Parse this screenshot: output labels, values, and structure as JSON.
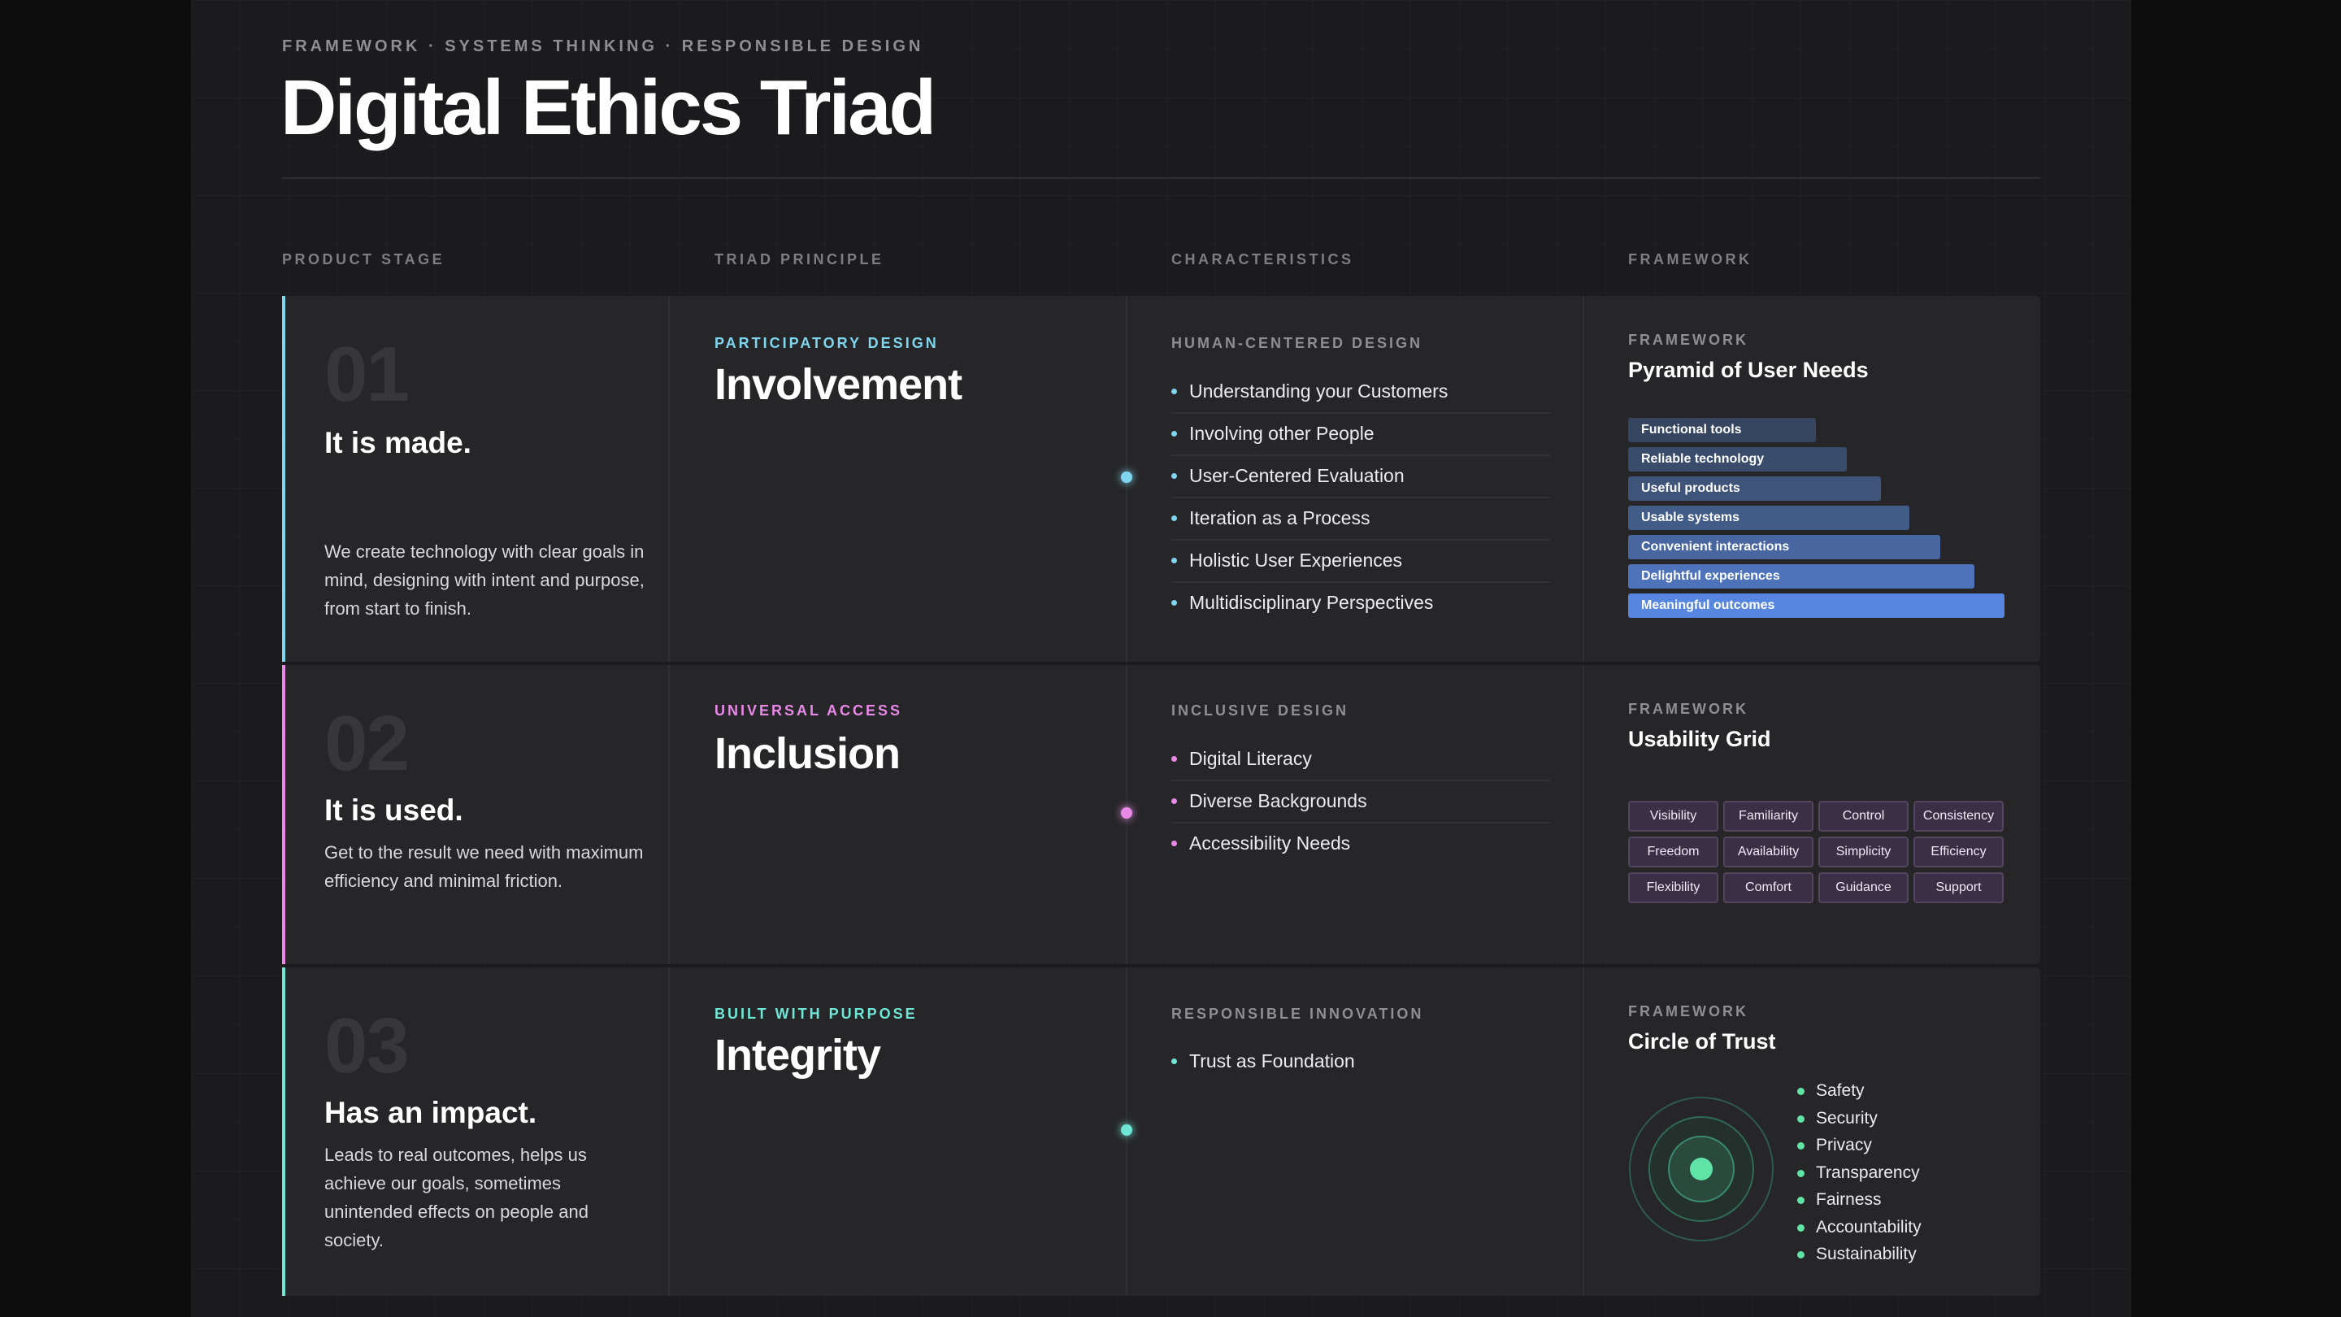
{
  "header": {
    "eyebrow": "FRAMEWORK · SYSTEMS THINKING · RESPONSIBLE DESIGN",
    "title": "Digital Ethics Triad"
  },
  "columns": [
    "PRODUCT STAGE",
    "TRIAD PRINCIPLE",
    "CHARACTERISTICS",
    "FRAMEWORK"
  ],
  "colors": {
    "row1_accent": "#7fd6ef",
    "row2_accent": "#e889e8",
    "row3_accent": "#6fe6d6",
    "pyramid_light": "#3a4c72",
    "pyramid_strong": "#5686e0",
    "trust_green": "#5fe3a7"
  },
  "rows": [
    {
      "number": "01",
      "stage_title": "It is made.",
      "stage_desc": "We create technology with clear goals in mind, designing with intent and purpose, from start to finish.",
      "tag": "PARTICIPATORY DESIGN",
      "principle": "Involvement",
      "char_heading": "HUMAN-CENTERED DESIGN",
      "characteristics": [
        "Understanding your Customers",
        "Involving other People",
        "User-Centered Evaluation",
        "Iteration as a Process",
        "Holistic User Experiences",
        "Multidisciplinary Perspectives"
      ],
      "framework_label": "FRAMEWORK",
      "framework_title": "Pyramid of User Needs",
      "pyramid": [
        "Functional tools",
        "Reliable technology",
        "Useful products",
        "Usable systems",
        "Convenient interactions",
        "Delightful experiences",
        "Meaningful outcomes"
      ]
    },
    {
      "number": "02",
      "stage_title": "It is used.",
      "stage_desc": "Get to the result we need with maximum efficiency and minimal friction.",
      "tag": "UNIVERSAL ACCESS",
      "principle": "Inclusion",
      "char_heading": "INCLUSIVE DESIGN",
      "characteristics": [
        "Digital Literacy",
        "Diverse Backgrounds",
        "Accessibility Needs"
      ],
      "framework_label": "FRAMEWORK",
      "framework_title": "Usability Grid",
      "grid": [
        "Visibility",
        "Familiarity",
        "Control",
        "Consistency",
        "Freedom",
        "Availability",
        "Simplicity",
        "Efficiency",
        "Flexibility",
        "Comfort",
        "Guidance",
        "Support"
      ]
    },
    {
      "number": "03",
      "stage_title": "Has an impact.",
      "stage_desc": "Leads to real outcomes, helps us achieve our goals, sometimes unintended effects on people and society.",
      "tag": "BUILT WITH PURPOSE",
      "principle": "Integrity",
      "char_heading": "RESPONSIBLE INNOVATION",
      "characteristics": [
        "Trust as Foundation"
      ],
      "framework_label": "FRAMEWORK",
      "framework_title": "Circle of Trust",
      "trust": [
        "Safety",
        "Security",
        "Privacy",
        "Transparency",
        "Fairness",
        "Accountability",
        "Sustainability"
      ]
    }
  ]
}
